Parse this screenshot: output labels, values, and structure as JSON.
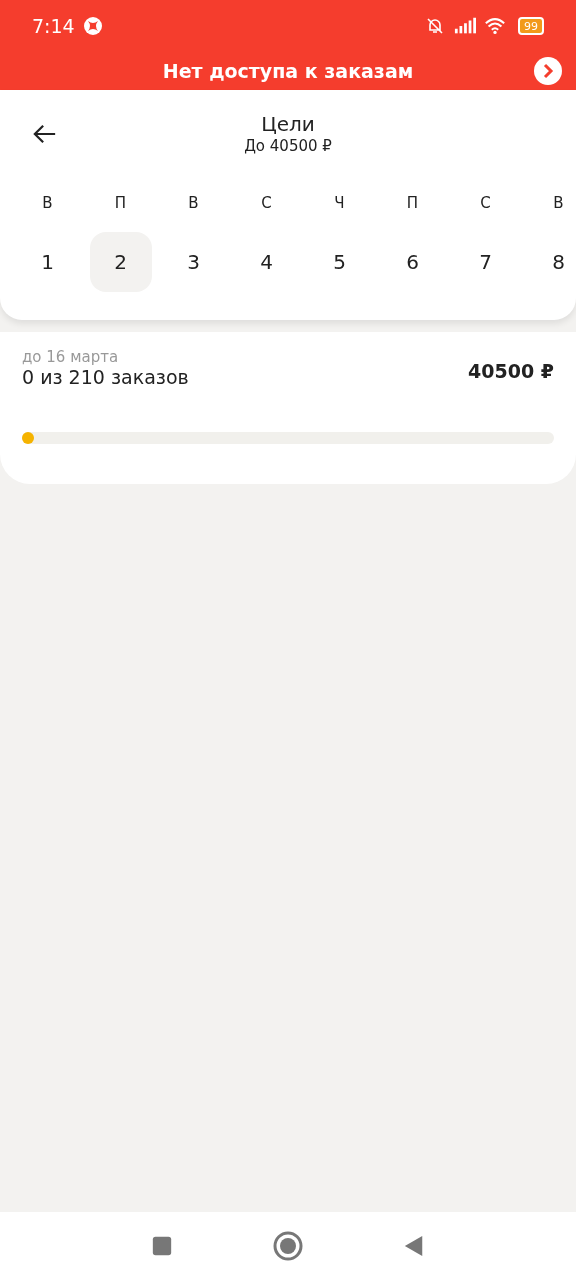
{
  "status_bar": {
    "time": "7:14",
    "battery": "99"
  },
  "banner": {
    "text": "Нет доступа к заказам"
  },
  "header": {
    "title": "Цели",
    "subtitle": "До 40500 ₽"
  },
  "days": [
    {
      "weekday": "В",
      "date": "1",
      "selected": false
    },
    {
      "weekday": "П",
      "date": "2",
      "selected": true
    },
    {
      "weekday": "В",
      "date": "3",
      "selected": false
    },
    {
      "weekday": "С",
      "date": "4",
      "selected": false
    },
    {
      "weekday": "Ч",
      "date": "5",
      "selected": false
    },
    {
      "weekday": "П",
      "date": "6",
      "selected": false
    },
    {
      "weekday": "С",
      "date": "7",
      "selected": false
    },
    {
      "weekday": "В",
      "date": "8",
      "selected": false
    }
  ],
  "goal": {
    "deadline": "до 16 марта",
    "progress_text": "0 из 210 заказов",
    "amount": "40500 ₽",
    "level": 0
  }
}
